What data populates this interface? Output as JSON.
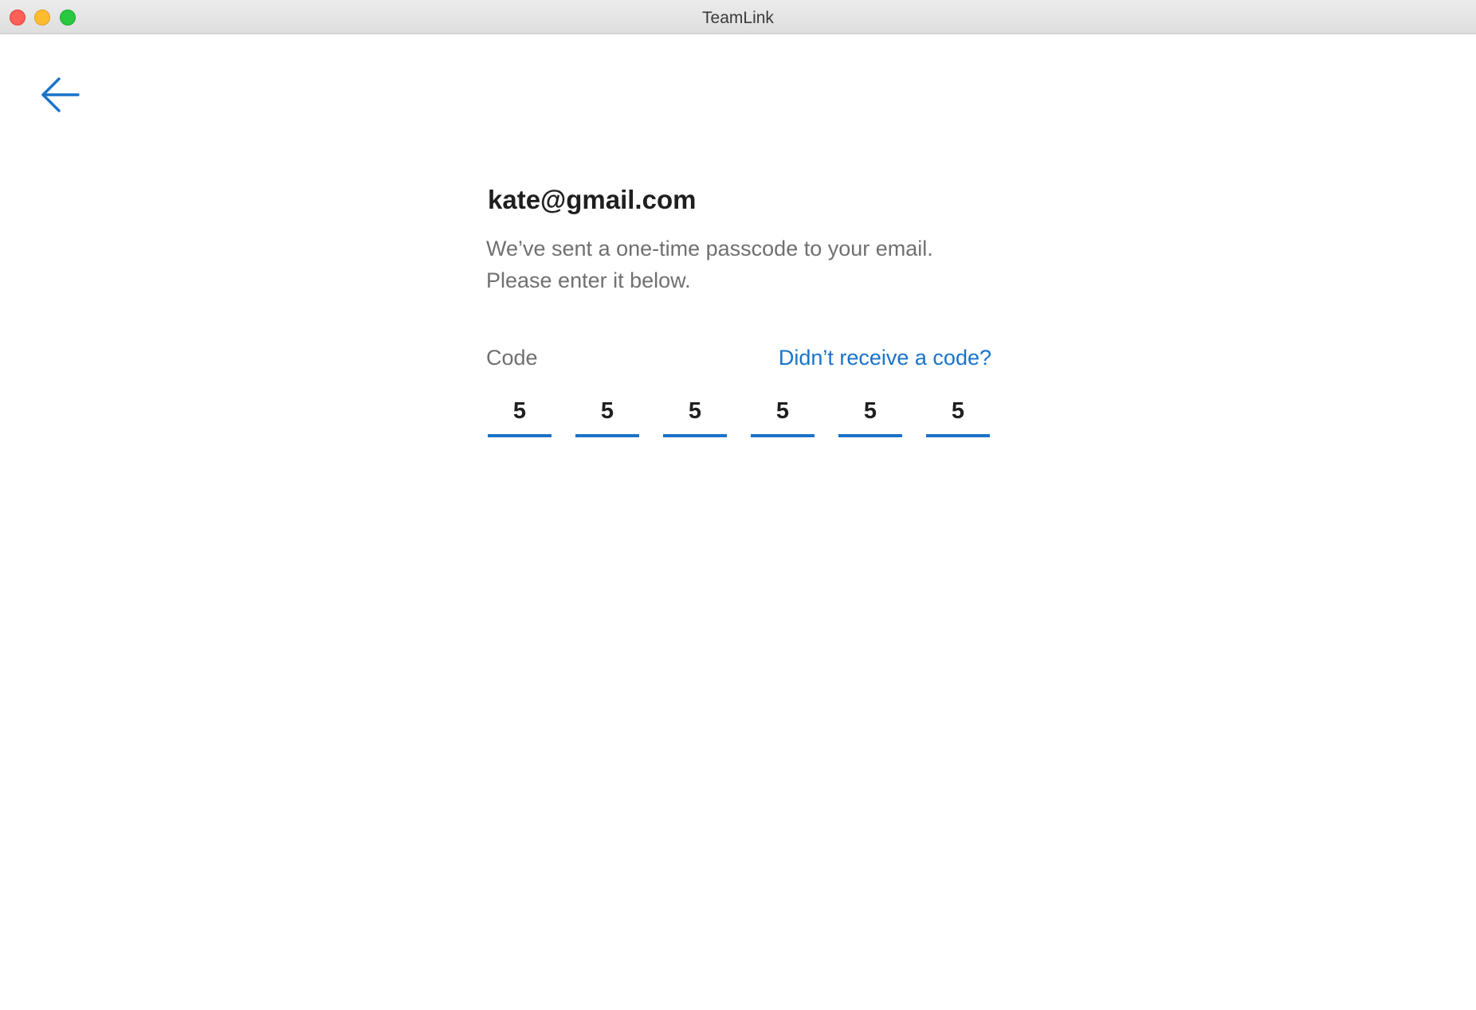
{
  "window": {
    "title": "TeamLink"
  },
  "nav": {
    "back_icon": "arrow-left-icon"
  },
  "content": {
    "email": "kate@gmail.com",
    "message_line1": "We’ve sent a one-time passcode to your email.",
    "message_line2": "Please enter it below."
  },
  "code": {
    "label": "Code",
    "resend_link": "Didn’t receive a code?",
    "digits": [
      "5",
      "5",
      "5",
      "5",
      "5",
      "5"
    ]
  },
  "colors": {
    "accent": "#1a73c8",
    "text_primary": "#1f1f1f",
    "text_secondary": "#707070"
  }
}
